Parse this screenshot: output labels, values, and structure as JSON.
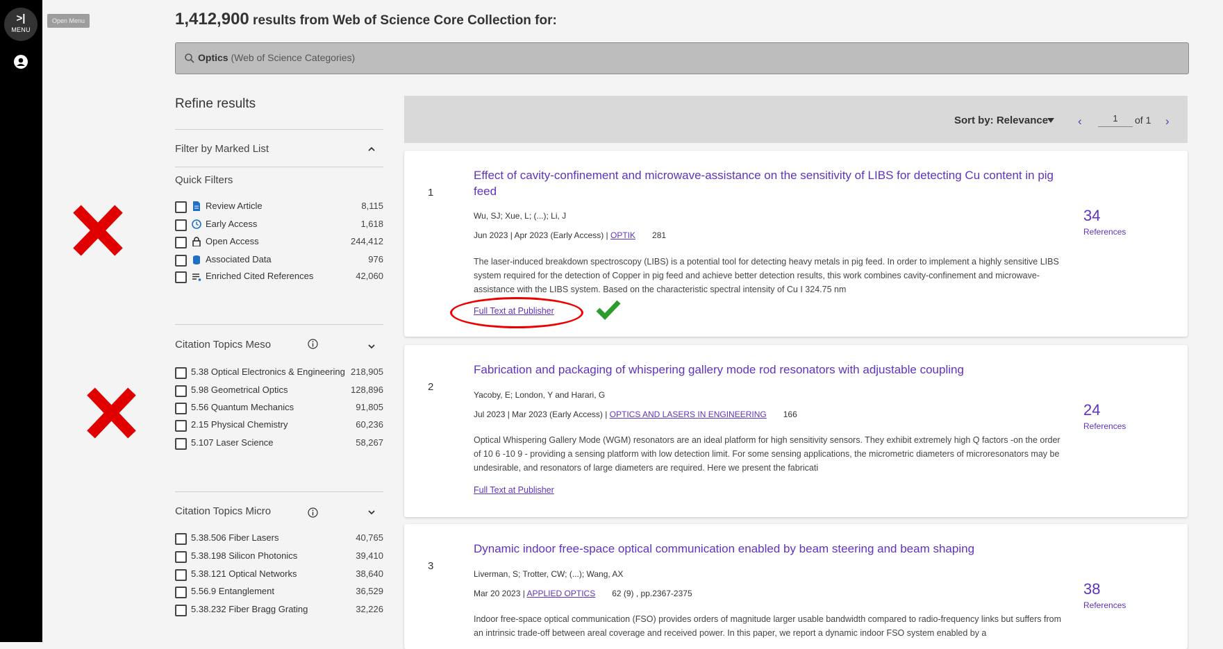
{
  "sidebar": {
    "menu_arrow": ">|",
    "menu_label": "MENU",
    "tooltip": "Open Menu"
  },
  "header": {
    "count": "1,412,900",
    "text": " results from Web of Science Core Collection for:"
  },
  "search": {
    "query": "Optics",
    "category": " (Web of Science Categories)"
  },
  "refine": {
    "title": "Refine results",
    "marked_list": "Filter by Marked List",
    "quick_filters": {
      "title": "Quick Filters",
      "items": [
        {
          "label": "Review Article",
          "count": "8,115",
          "icon": "document-icon"
        },
        {
          "label": "Early Access",
          "count": "1,618",
          "icon": "clock-icon"
        },
        {
          "label": "Open Access",
          "count": "244,412",
          "icon": "lock-open-icon"
        },
        {
          "label": "Associated Data",
          "count": "976",
          "icon": "database-icon"
        },
        {
          "label": "Enriched Cited References",
          "count": "42,060",
          "icon": "enriched-list-icon"
        }
      ]
    },
    "meso": {
      "title": "Citation Topics Meso",
      "items": [
        {
          "label": "5.38 Optical Electronics & Engineering",
          "count": "218,905"
        },
        {
          "label": "5.98 Geometrical Optics",
          "count": "128,896"
        },
        {
          "label": "5.56 Quantum Mechanics",
          "count": "91,805"
        },
        {
          "label": "2.15 Physical Chemistry",
          "count": "60,236"
        },
        {
          "label": "5.107 Laser Science",
          "count": "58,267"
        }
      ]
    },
    "micro": {
      "title": "Citation Topics Micro",
      "items": [
        {
          "label": "5.38.506 Fiber Lasers",
          "count": "40,765"
        },
        {
          "label": "5.38.198 Silicon Photonics",
          "count": "39,410"
        },
        {
          "label": "5.38.121 Optical Networks",
          "count": "38,640"
        },
        {
          "label": "5.56.9 Entanglement",
          "count": "36,529"
        },
        {
          "label": "5.38.232 Fiber Bragg Grating",
          "count": "32,226"
        }
      ]
    }
  },
  "sort": {
    "label": "Sort by: Relevance",
    "page": "1",
    "of": "of 1",
    "prev": "‹",
    "next": "›"
  },
  "results": [
    {
      "index": "1",
      "title": "Effect of cavity-confinement and microwave-assistance on the sensitivity of LIBS for detecting Cu content in pig feed",
      "authors": "Wu, SJ; Xue, L; (...); Li, J",
      "date": "Jun 2023 | Apr 2023 (Early Access) | ",
      "journal": "OPTIK",
      "vol": "281",
      "abstract": "The laser-induced breakdown spectroscopy (LIBS) is a potential tool for detecting heavy metals in pig feed. In order to implement a highly sensitive LIBS system required for the detection of Copper in pig feed and achieve better detection results, this work combines cavity-confinement and microwave-assistance with the LIBS system. Based on the characteristic spectral intensity of Cu I 324.75 nm",
      "fulltext": "Full Text at Publisher",
      "refs": "34",
      "refs_label": "References"
    },
    {
      "index": "2",
      "title": "Fabrication and packaging of whispering gallery mode rod resonators with adjustable coupling",
      "authors": "Yacoby, E; London, Y and Harari, G",
      "date": "Jul 2023 | Mar 2023 (Early Access) | ",
      "journal": "OPTICS AND LASERS IN ENGINEERING",
      "vol": "166",
      "abstract": "Optical Whispering Gallery Mode (WGM) resonators are an ideal platform for high sensitivity sensors. They exhibit extremely high Q factors -on the order of 10 6 -10 9 - providing a sensing platform with low detection limit. For some sensing applications, the micrometric diameters of microresonators may be undesirable, and resonators of large diameters are required. Here we present the fabricati",
      "fulltext": "Full Text at Publisher",
      "refs": "24",
      "refs_label": "References"
    },
    {
      "index": "3",
      "title": "Dynamic indoor free-space optical communication enabled by beam steering and beam shaping",
      "authors": "Liverman, S; Trotter, CW; (...); Wang, AX",
      "date": "Mar 20 2023 | ",
      "journal": "APPLIED OPTICS",
      "vol": "62 (9) , pp.2367-2375",
      "abstract": "Indoor free-space optical communication (FSO) provides orders of magnitude larger usable bandwidth compared to radio-frequency links but suffers from an intrinsic trade-off between areal coverage and received power. In this paper, we report a dynamic indoor FSO system enabled by a",
      "refs": "38",
      "refs_label": "References"
    }
  ],
  "colors": {
    "accent": "#5e33bf",
    "annotation_red": "#e00000",
    "check_green": "#2e9b2e"
  }
}
